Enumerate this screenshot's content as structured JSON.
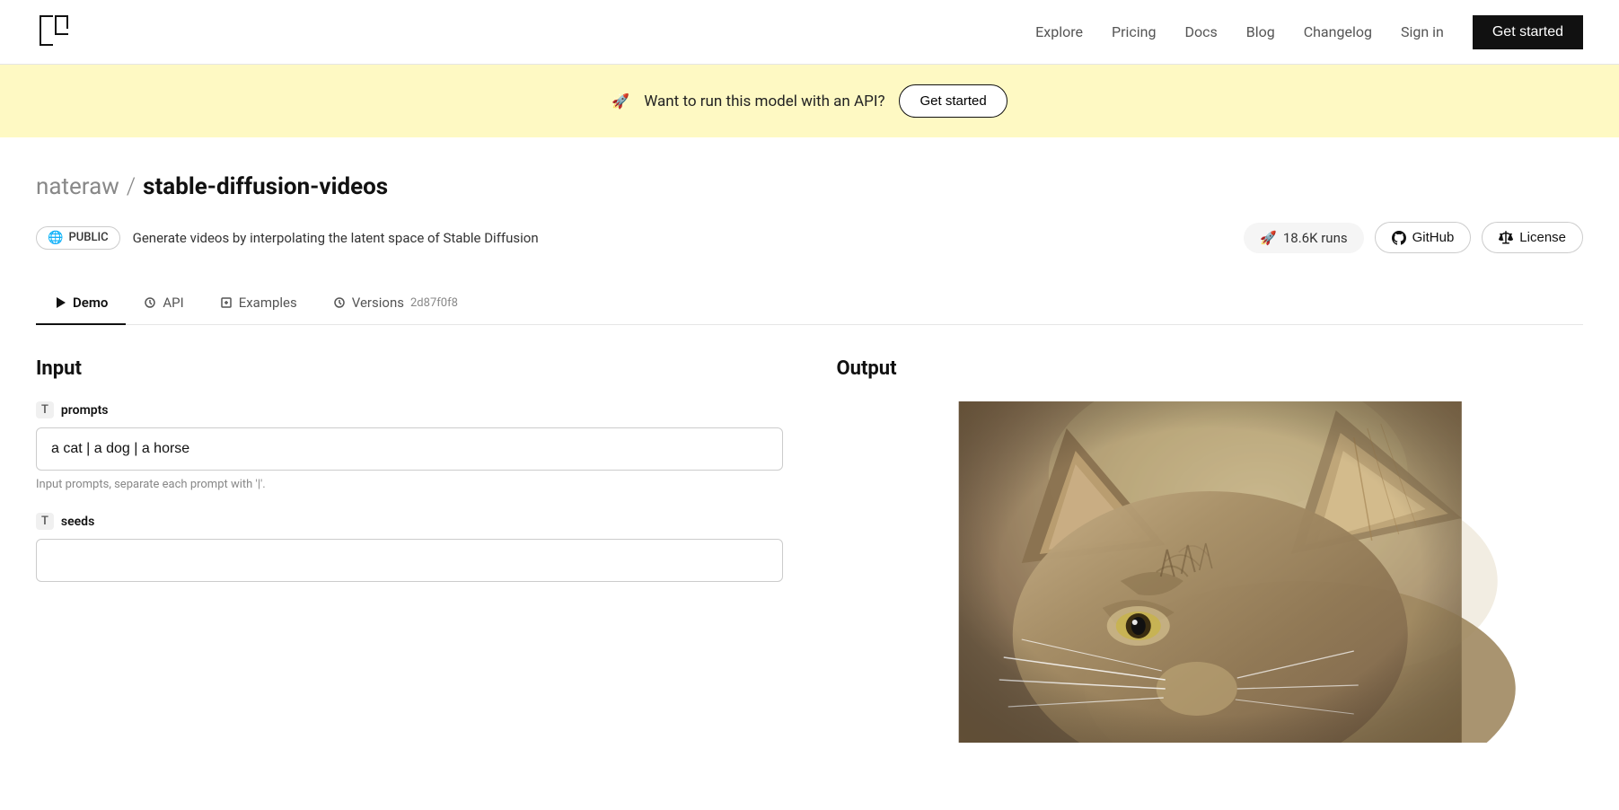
{
  "nav": {
    "logo_text": "r",
    "links": [
      {
        "label": "Explore",
        "href": "#"
      },
      {
        "label": "Pricing",
        "href": "#"
      },
      {
        "label": "Docs",
        "href": "#"
      },
      {
        "label": "Blog",
        "href": "#"
      },
      {
        "label": "Changelog",
        "href": "#"
      },
      {
        "label": "Sign in",
        "href": "#"
      }
    ],
    "cta_label": "Get started"
  },
  "banner": {
    "emoji": "🚀",
    "text": "Want to run this model with an API?",
    "cta_label": "Get started"
  },
  "model": {
    "user": "nateraw",
    "separator": "/",
    "repo": "stable-diffusion-videos",
    "badge": "PUBLIC",
    "description": "Generate videos by interpolating the latent space of Stable Diffusion",
    "runs": "18.6K runs",
    "github_label": "GitHub",
    "license_label": "License"
  },
  "tabs": [
    {
      "label": "Demo",
      "icon": "play",
      "active": true
    },
    {
      "label": "API",
      "icon": "api"
    },
    {
      "label": "Examples",
      "icon": "examples"
    },
    {
      "label": "Versions",
      "icon": "versions",
      "hash": "2d87f0f8"
    }
  ],
  "input": {
    "section_title": "Input",
    "prompts_field": {
      "type_label": "T",
      "field_name": "prompts",
      "value": "a cat | a dog | a horse",
      "hint": "Input prompts, separate each prompt with '|'."
    },
    "seeds_field": {
      "type_label": "T",
      "field_name": "seeds",
      "value": ""
    }
  },
  "output": {
    "section_title": "Output"
  },
  "colors": {
    "banner_bg": "#fef9c3",
    "nav_cta_bg": "#111111",
    "active_tab_border": "#111111"
  }
}
